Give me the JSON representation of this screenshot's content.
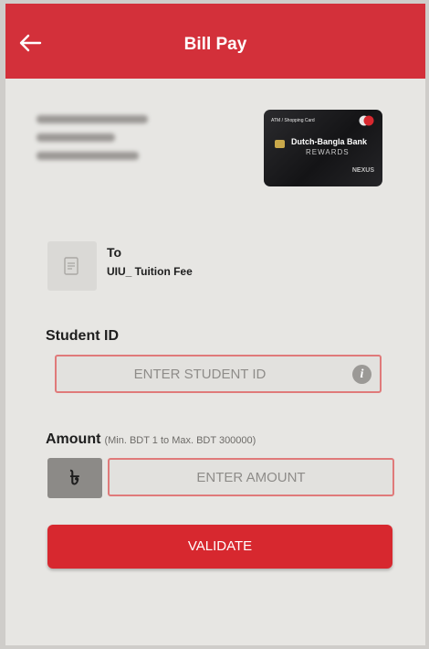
{
  "header": {
    "title": "Bill Pay",
    "back_icon": "arrow-left-icon"
  },
  "card": {
    "type_label": "ATM / Shopping Card",
    "bank_name": "Dutch-Bangla Bank",
    "program": "REWARDS",
    "network": "NEXUS"
  },
  "biller": {
    "to_label": "To",
    "name": "UIU_ Tuition Fee",
    "icon": "document-icon"
  },
  "form": {
    "student_id_label": "Student ID",
    "student_id_placeholder": "ENTER STUDENT ID",
    "info_icon": "info-icon",
    "amount_label": "Amount",
    "amount_hint": "(Min. BDT 1 to Max. BDT 300000)",
    "currency_symbol": "৳",
    "amount_placeholder": "ENTER AMOUNT",
    "validate_label": "VALIDATE"
  },
  "colors": {
    "brand_red": "#d3303a",
    "highlight_border": "#e07a7a"
  }
}
